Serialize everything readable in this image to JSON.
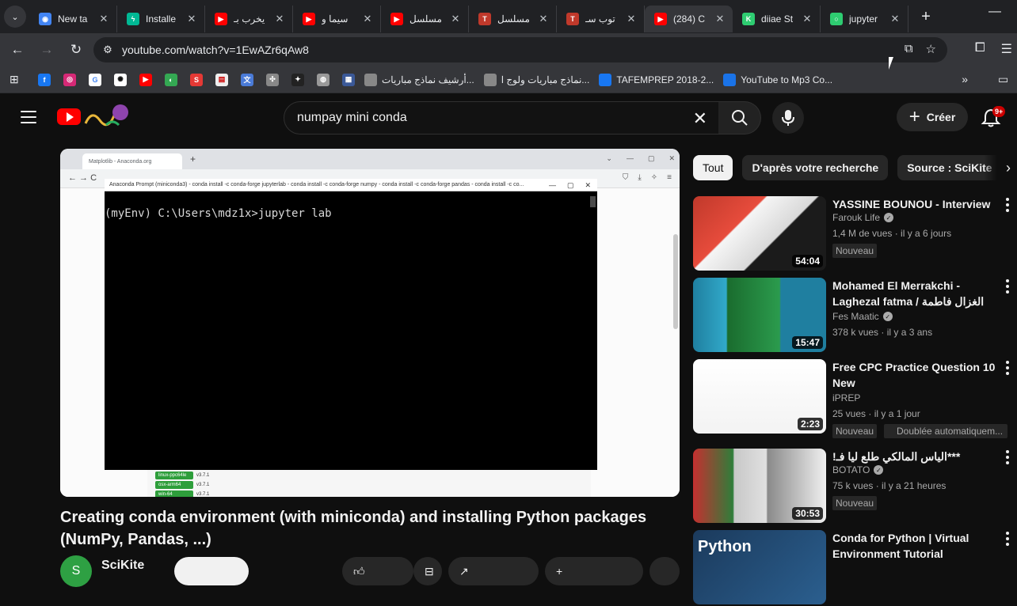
{
  "browser": {
    "tabs": [
      {
        "label": "New ta",
        "icon": "chrome-icon",
        "color": "#4285f4",
        "glyph": "◉"
      },
      {
        "label": "Installe",
        "icon": "bolt-icon",
        "color": "#00b894",
        "glyph": "ϟ"
      },
      {
        "label": "يخرب بـ",
        "icon": "youtube-icon",
        "color": "#ff0000",
        "glyph": "▶"
      },
      {
        "label": "سيما و",
        "icon": "youtube-icon",
        "color": "#ff0000",
        "glyph": "▶"
      },
      {
        "label": "مسلسل",
        "icon": "youtube-icon",
        "color": "#ff0000",
        "glyph": "▶"
      },
      {
        "label": "مسلسل",
        "icon": "tou-icon",
        "color": "#c0392b",
        "glyph": "T"
      },
      {
        "label": "توب سـ",
        "icon": "tou-icon",
        "color": "#c0392b",
        "glyph": "T"
      },
      {
        "label": "(284) C",
        "icon": "youtube-icon",
        "color": "#ff0000",
        "glyph": "▶",
        "active": true
      },
      {
        "label": "diiae St",
        "icon": "k-icon",
        "color": "#2ecc71",
        "glyph": "K"
      },
      {
        "label": "jupyter",
        "icon": "jupyter-icon",
        "color": "#2ecc71",
        "glyph": "○"
      }
    ],
    "url": "youtube.com/watch?v=1EwAZr6qAw8",
    "bookmarks": [
      {
        "label": "أرشيف نماذج مباريات...",
        "icon": "bookmark-image-icon",
        "color": "#888"
      },
      {
        "label": "نماذج مباريات ولوج ا...",
        "icon": "bookmark-image-icon",
        "color": "#888"
      },
      {
        "label": "TAFEMPREP 2018-2...",
        "icon": "facebook-icon",
        "color": "#1877f2"
      },
      {
        "label": "YouTube to Mp3 Co...",
        "icon": "yt-mp3-icon",
        "color": "#1a73e8"
      }
    ]
  },
  "youtube": {
    "search_query": "numpay mini conda",
    "create_label": "Créer",
    "notification_count": "9+",
    "video": {
      "title": "Creating conda environment (with miniconda) and installing Python packages (NumPy, Pandas, ...)",
      "channel": "SciKite",
      "channel_initial": "S",
      "inner_tab": "Matplotlib - Anaconda.org",
      "terminal_title": "Anaconda Prompt (miniconda3) - conda install -c conda-forge jupyterlab - conda install -c conda-forge numpy - conda install -c conda-forge pandas - conda install -c co...",
      "terminal_line": "(myEnv) C:\\Users\\mdz1x>jupyter lab",
      "inner_rows": [
        "linux-ppc64le",
        "osx-arm64",
        "win-64"
      ],
      "inner_vals": [
        "v3.7.1",
        "v3.7.1",
        "v3.7.1"
      ]
    },
    "chips": [
      {
        "label": "Tout",
        "active": true
      },
      {
        "label": "D'après votre recherche"
      },
      {
        "label": "Source : SciKite"
      }
    ],
    "recommendations": [
      {
        "title": "YASSINE BOUNOU - Interview",
        "channel": "Farouk Life",
        "verified": true,
        "meta": "1,4 M de vues · il y a 6 jours",
        "duration": "54:04",
        "badge": "Nouveau"
      },
      {
        "title": "Mohamed El Merrakchi - Laghezal fatma / الغزال فاطمة",
        "channel": "Fes Maatic",
        "verified": true,
        "meta": "378 k vues · il y a 3 ans",
        "duration": "15:47"
      },
      {
        "title": "Free CPC Practice Question 10 New",
        "channel": "iPREP",
        "verified": false,
        "meta": "25 vues · il y a 1 jour",
        "duration": "2:23",
        "badge": "Nouveau",
        "badge2": "Doublée automatiquem..."
      },
      {
        "title": "!الياس المالكي طلع ليا فـ***",
        "channel": "BOTATO",
        "verified": true,
        "meta": "75 k vues · il y a 21 heures",
        "duration": "30:53",
        "badge": "Nouveau"
      },
      {
        "title": "Conda for Python | Virtual Environment Tutorial (Anacon...",
        "channel": "",
        "verified": false,
        "meta": "",
        "thumb_text": "Python"
      }
    ]
  }
}
